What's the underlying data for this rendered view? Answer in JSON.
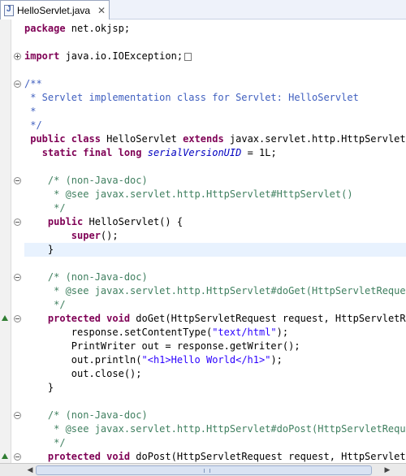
{
  "editor": {
    "tab": {
      "title": "HelloServlet.java",
      "close_glyph": "✕",
      "file_icon": "java-file-icon"
    },
    "fold_markers": [
      "plus",
      "minus",
      "minus",
      "minus",
      "minus",
      "minus",
      "minus"
    ],
    "lines": [
      {
        "tokens": [
          {
            "t": "kw",
            "v": "package"
          },
          {
            "t": "",
            "v": " net.okjsp;"
          }
        ]
      },
      {
        "tokens": []
      },
      {
        "tokens": [
          {
            "t": "kw",
            "v": "import"
          },
          {
            "t": "",
            "v": " java.io.IOException;"
          }
        ],
        "folded": true
      },
      {
        "tokens": []
      },
      {
        "tokens": [
          {
            "t": "jd",
            "v": "/**"
          }
        ]
      },
      {
        "tokens": [
          {
            "t": "jd",
            "v": " * Servlet implementation class for Servlet: HelloServlet"
          }
        ]
      },
      {
        "tokens": [
          {
            "t": "jd",
            "v": " *"
          }
        ]
      },
      {
        "tokens": [
          {
            "t": "jd",
            "v": " */"
          }
        ]
      },
      {
        "tokens": [
          {
            "t": "",
            "v": " "
          },
          {
            "t": "kw",
            "v": "public class"
          },
          {
            "t": "",
            "v": " HelloServlet "
          },
          {
            "t": "kw",
            "v": "extends"
          },
          {
            "t": "",
            "v": " javax.servlet.http.HttpServlet"
          }
        ]
      },
      {
        "tokens": [
          {
            "t": "",
            "v": "   "
          },
          {
            "t": "kw",
            "v": "static final long"
          },
          {
            "t": "",
            "v": " "
          },
          {
            "t": "it",
            "v": "serialVersionUID"
          },
          {
            "t": "",
            "v": " = 1L;"
          }
        ]
      },
      {
        "tokens": []
      },
      {
        "tokens": [
          {
            "t": "",
            "v": "    "
          },
          {
            "t": "cm",
            "v": "/* (non-Java-doc)"
          }
        ]
      },
      {
        "tokens": [
          {
            "t": "cm",
            "v": "     * @see javax.servlet.http.HttpServlet#HttpServlet()"
          }
        ]
      },
      {
        "tokens": [
          {
            "t": "cm",
            "v": "     */"
          }
        ]
      },
      {
        "tokens": [
          {
            "t": "",
            "v": "    "
          },
          {
            "t": "kw",
            "v": "public"
          },
          {
            "t": "",
            "v": " HelloServlet() {"
          }
        ]
      },
      {
        "tokens": [
          {
            "t": "",
            "v": "        "
          },
          {
            "t": "kw",
            "v": "super"
          },
          {
            "t": "",
            "v": "();"
          }
        ]
      },
      {
        "tokens": [
          {
            "t": "",
            "v": "    }"
          }
        ],
        "current": true
      },
      {
        "tokens": []
      },
      {
        "tokens": [
          {
            "t": "",
            "v": "    "
          },
          {
            "t": "cm",
            "v": "/* (non-Java-doc)"
          }
        ]
      },
      {
        "tokens": [
          {
            "t": "cm",
            "v": "     * @see javax.servlet.http.HttpServlet#doGet(HttpServletRequest request, HttpServletResponse response)"
          }
        ]
      },
      {
        "tokens": [
          {
            "t": "cm",
            "v": "     */"
          }
        ]
      },
      {
        "tokens": [
          {
            "t": "",
            "v": "    "
          },
          {
            "t": "kw",
            "v": "protected void"
          },
          {
            "t": "",
            "v": " doGet(HttpServletRequest request, HttpServletResponse response)"
          }
        ]
      },
      {
        "tokens": [
          {
            "t": "",
            "v": "        response.setContentType("
          },
          {
            "t": "str",
            "v": "\"text/html\""
          },
          {
            "t": "",
            "v": ");"
          }
        ]
      },
      {
        "tokens": [
          {
            "t": "",
            "v": "        PrintWriter out = response.getWriter();"
          }
        ]
      },
      {
        "tokens": [
          {
            "t": "",
            "v": "        out.println("
          },
          {
            "t": "str",
            "v": "\"<h1>Hello World</h1>\""
          },
          {
            "t": "",
            "v": ");"
          }
        ]
      },
      {
        "tokens": [
          {
            "t": "",
            "v": "        out.close();"
          }
        ]
      },
      {
        "tokens": [
          {
            "t": "",
            "v": "    }"
          }
        ]
      },
      {
        "tokens": []
      },
      {
        "tokens": [
          {
            "t": "",
            "v": "    "
          },
          {
            "t": "cm",
            "v": "/* (non-Java-doc)"
          }
        ]
      },
      {
        "tokens": [
          {
            "t": "cm",
            "v": "     * @see javax.servlet.http.HttpServlet#doPost(HttpServletRequest request, HttpServletResponse response)"
          }
        ]
      },
      {
        "tokens": [
          {
            "t": "cm",
            "v": "     */"
          }
        ]
      },
      {
        "tokens": [
          {
            "t": "",
            "v": "    "
          },
          {
            "t": "kw",
            "v": "protected void"
          },
          {
            "t": "",
            "v": " doPost(HttpServletRequest request, HttpServletResponse response)"
          }
        ]
      }
    ]
  },
  "scrollbar": {
    "left_arrow": "◀",
    "right_arrow": "▶"
  },
  "colors": {
    "keyword": "#7f0055",
    "comment": "#3f7f5f",
    "javadoc": "#3f5fbf",
    "string": "#2a00ff",
    "field": "#0000c0",
    "current_line": "#e8f2fe"
  }
}
